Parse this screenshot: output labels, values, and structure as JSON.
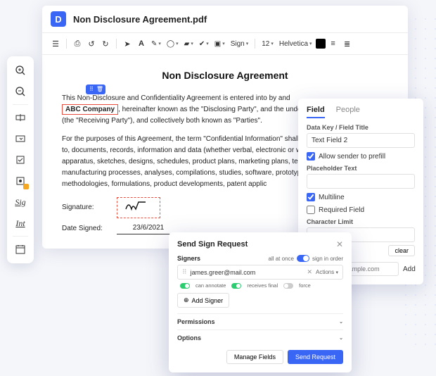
{
  "window": {
    "title": "Non Disclosure Agreement.pdf"
  },
  "toolbar": {
    "sign_label": "Sign",
    "font_size": "12",
    "font_family": "Helvetica"
  },
  "document": {
    "title": "Non Disclosure Agreement",
    "para1_a": "This Non-Disclosure and Confidentiality Agreement is entered into by and",
    "company_field": "ABC Company",
    "para1_b": ", hereinafter known as the \"Disclosing Party\", and the undersigned Receiving party (the \"Receiving Party\"), and collectively both known as \"Parties\".",
    "para2": "For the purposes of this Agreement, the term \"Confidential Information\" shall include, but not be limited to, documents, records, information and data (whether verbal, electronic or written), drawings, models, apparatus, sketches, designs, schedules, product plans, marketing plans, technical procedures, manufacturing processes, analyses, compilations, studies, software, prototypes, samples, formulas, methodologies, formulations, product developments, patent applic",
    "signature_label": "Signature:",
    "date_label": "Date Signed:",
    "date_value": "23/6/2021"
  },
  "field_panel": {
    "tab_field": "Field",
    "tab_people": "People",
    "data_key_label": "Data Key / Field Title",
    "data_key_value": "Text Field 2",
    "allow_prefill": "Allow sender to prefill",
    "placeholder_label": "Placeholder Text",
    "multiline": "Multiline",
    "required": "Required Field",
    "charlimit_label": "Character Limit",
    "clear": "clear",
    "add_email_placeholder": "example@example.com",
    "add": "Add"
  },
  "sign_dialog": {
    "title": "Send Sign Request",
    "signers_label": "Signers",
    "all_at_once": "all at once",
    "sign_in_order": "sign in order",
    "signer_email": "james.greer@mail.com",
    "actions": "Actions",
    "perm_annotate": "can annotate",
    "perm_final": "receives final",
    "perm_force": "force",
    "add_signer": "Add Signer",
    "permissions": "Permissions",
    "options": "Options",
    "manage_fields": "Manage Fields",
    "send_request": "Send Request"
  }
}
